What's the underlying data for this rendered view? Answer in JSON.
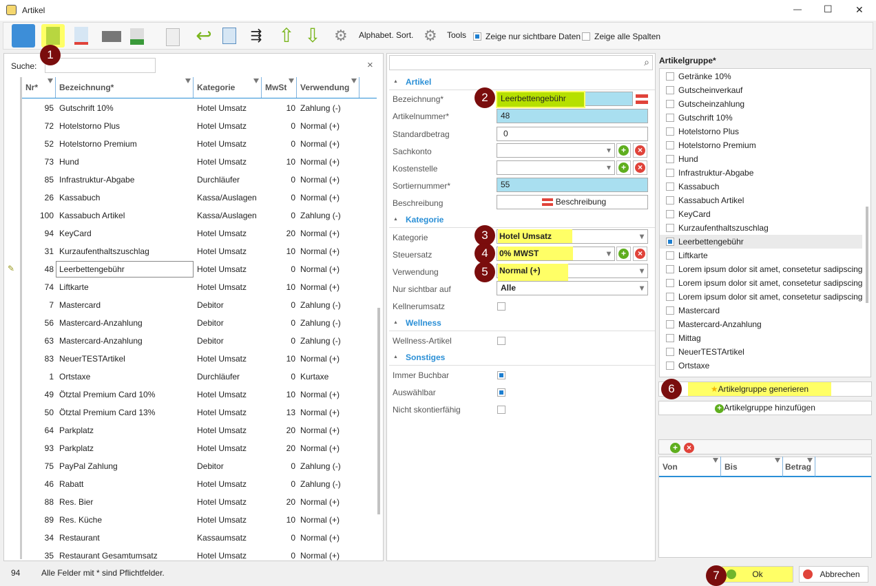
{
  "window": {
    "title": "Artikel",
    "minimize": "—",
    "maximize": "☐",
    "close": "✕"
  },
  "toolbar": {
    "alpha_sort": "Alphabet. Sort.",
    "tools": "Tools",
    "show_visible": "Zeige nur sichtbare Daten",
    "show_visible_checked": true,
    "show_all_cols": "Zeige alle Spalten",
    "show_all_cols_checked": false
  },
  "search": {
    "label": "Suche:",
    "value": "",
    "clear": "×"
  },
  "table": {
    "headers": [
      "Nr*",
      "Bezeichnung*",
      "Kategorie",
      "MwSt",
      "Verwendung"
    ],
    "selected_index": 9,
    "rows": [
      [
        "95",
        "Gutschrift 10%",
        "Hotel Umsatz",
        "10",
        "Zahlung (-)"
      ],
      [
        "72",
        "Hotelstorno Plus",
        "Hotel Umsatz",
        "0",
        "Normal (+)"
      ],
      [
        "52",
        "Hotelstorno Premium",
        "Hotel Umsatz",
        "0",
        "Normal (+)"
      ],
      [
        "73",
        "Hund",
        "Hotel Umsatz",
        "10",
        "Normal (+)"
      ],
      [
        "85",
        "Infrastruktur-Abgabe",
        "Durchläufer",
        "0",
        "Normal (+)"
      ],
      [
        "26",
        "Kassabuch",
        "Kassa/Auslagen",
        "0",
        "Normal (+)"
      ],
      [
        "100",
        "Kassabuch Artikel",
        "Kassa/Auslagen",
        "0",
        "Zahlung (-)"
      ],
      [
        "94",
        "KeyCard",
        "Hotel Umsatz",
        "20",
        "Normal (+)"
      ],
      [
        "31",
        "Kurzaufenthaltszuschlag",
        "Hotel Umsatz",
        "10",
        "Normal (+)"
      ],
      [
        "48",
        "Leerbettengebühr",
        "Hotel Umsatz",
        "0",
        "Normal (+)"
      ],
      [
        "74",
        "Liftkarte",
        "Hotel Umsatz",
        "10",
        "Normal (+)"
      ],
      [
        "7",
        "Mastercard",
        "Debitor",
        "0",
        "Zahlung (-)"
      ],
      [
        "56",
        "Mastercard-Anzahlung",
        "Debitor",
        "0",
        "Zahlung (-)"
      ],
      [
        "63",
        "Mastercard-Anzahlung",
        "Debitor",
        "0",
        "Zahlung (-)"
      ],
      [
        "83",
        "NeuerTESTArtikel",
        "Hotel Umsatz",
        "10",
        "Normal (+)"
      ],
      [
        "1",
        "Ortstaxe",
        "Durchläufer",
        "0",
        "Kurtaxe"
      ],
      [
        "49",
        "Ötztal Premium Card 10%",
        "Hotel Umsatz",
        "10",
        "Normal (+)"
      ],
      [
        "50",
        "Ötztal Premium Card 13%",
        "Hotel Umsatz",
        "13",
        "Normal (+)"
      ],
      [
        "64",
        "Parkplatz",
        "Hotel Umsatz",
        "20",
        "Normal (+)"
      ],
      [
        "93",
        "Parkplatz",
        "Hotel Umsatz",
        "20",
        "Normal (+)"
      ],
      [
        "75",
        "PayPal Zahlung",
        "Debitor",
        "0",
        "Zahlung (-)"
      ],
      [
        "46",
        "Rabatt",
        "Hotel Umsatz",
        "0",
        "Zahlung (-)"
      ],
      [
        "88",
        "Res. Bier",
        "Hotel Umsatz",
        "20",
        "Normal (+)"
      ],
      [
        "89",
        "Res. Küche",
        "Hotel Umsatz",
        "10",
        "Normal (+)"
      ],
      [
        "34",
        "Restaurant",
        "Kassaumsatz",
        "0",
        "Normal (+)"
      ],
      [
        "35",
        "Restaurant Gesamtumsatz",
        "Hotel Umsatz",
        "0",
        "Normal (+)"
      ]
    ]
  },
  "form": {
    "sections": {
      "artikel": "Artikel",
      "kategorie": "Kategorie",
      "wellness": "Wellness",
      "sonstiges": "Sonstiges"
    },
    "bezeichnung": {
      "label": "Bezeichnung*",
      "value": "Leerbettengebühr"
    },
    "artikelnummer": {
      "label": "Artikelnummer*",
      "value": "48"
    },
    "standardbetrag": {
      "label": "Standardbetrag",
      "value": "0"
    },
    "sachkonto": {
      "label": "Sachkonto",
      "value": ""
    },
    "kostenstelle": {
      "label": "Kostenstelle",
      "value": ""
    },
    "sortiernummer": {
      "label": "Sortiernummer*",
      "value": "55"
    },
    "beschreibung": {
      "label": "Beschreibung",
      "button": "Beschreibung"
    },
    "kategorie": {
      "label": "Kategorie",
      "value": "Hotel Umsatz"
    },
    "steuersatz": {
      "label": "Steuersatz",
      "value": "0% MWST"
    },
    "verwendung": {
      "label": "Verwendung",
      "value": "Normal (+)"
    },
    "sichtbar": {
      "label": "Nur sichtbar auf",
      "value": "Alle"
    },
    "kellnerumsatz": {
      "label": "Kellnerumsatz",
      "checked": false
    },
    "wellness_artikel": {
      "label": "Wellness-Artikel",
      "checked": false
    },
    "immer_buchbar": {
      "label": "Immer Buchbar",
      "checked": true
    },
    "auswaehlbar": {
      "label": "Auswählbar",
      "checked": true
    },
    "nicht_skonto": {
      "label": "Nicht skontierfähig",
      "checked": false
    }
  },
  "groups": {
    "title": "Artikelgruppe*",
    "selected": "Leerbettengebühr",
    "items": [
      "Getränke 10%",
      "Gutscheinverkauf",
      "Gutscheinzahlung",
      "Gutschrift 10%",
      "Hotelstorno Plus",
      "Hotelstorno Premium",
      "Hund",
      "Infrastruktur-Abgabe",
      "Kassabuch",
      "Kassabuch Artikel",
      "KeyCard",
      "Kurzaufenthaltszuschlag",
      "Leerbettengebühr",
      "Liftkarte",
      "Lorem ipsum dolor sit amet, consetetur sadipscing",
      "Lorem ipsum dolor sit amet, consetetur sadipscing",
      "Lorem ipsum dolor sit amet, consetetur sadipscing",
      "Mastercard",
      "Mastercard-Anzahlung",
      "Mittag",
      "NeuerTESTArtikel",
      "Ortstaxe"
    ],
    "generate": "Artikelgruppe generieren",
    "add": "Artikelgruppe hinzufügen"
  },
  "range_table": {
    "headers": [
      "Von",
      "Bis",
      "Betrag"
    ]
  },
  "status": {
    "count": "94",
    "message": "Alle Felder mit * sind Pflichtfelder."
  },
  "buttons": {
    "ok": "Ok",
    "cancel": "Abbrechen"
  },
  "badges": [
    "1",
    "2",
    "3",
    "4",
    "5",
    "6",
    "7"
  ],
  "colors": {
    "highlight": "#ffff66",
    "accent": "#2a8fd6",
    "required_field": "#a9dff0",
    "badge": "#7a0d0d"
  }
}
